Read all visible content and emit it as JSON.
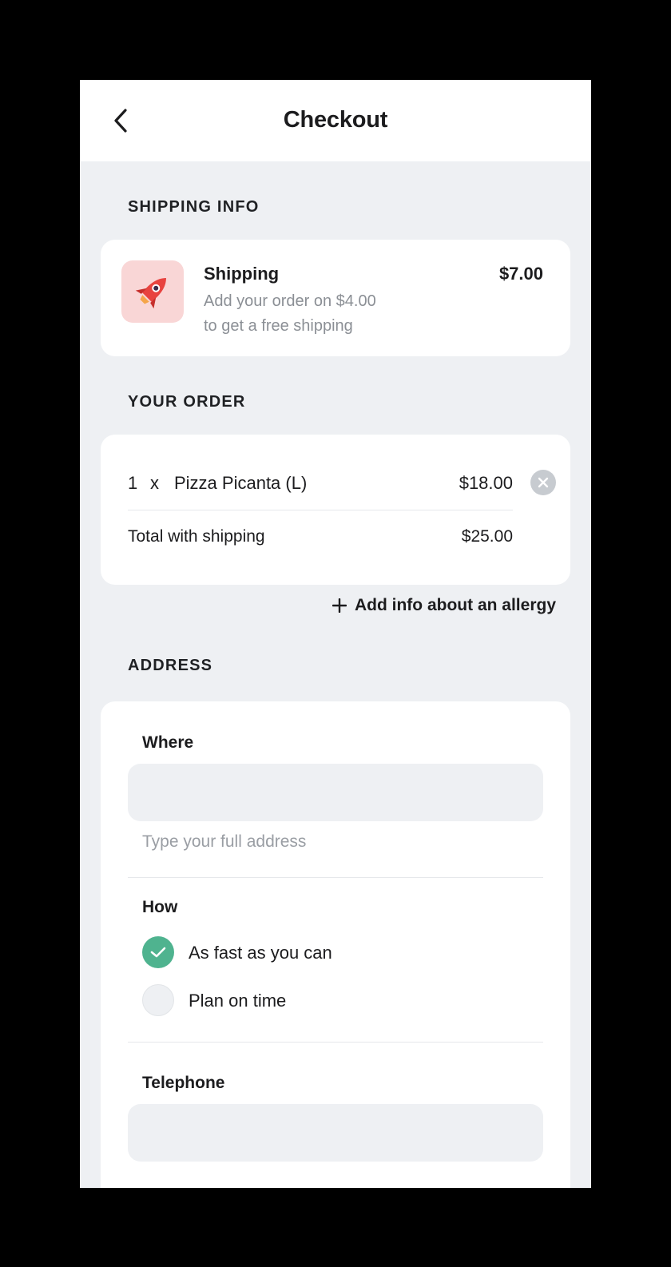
{
  "header": {
    "title": "Checkout",
    "back_icon": "chevron-left-icon"
  },
  "shipping_info": {
    "section_title": "SHIPPING INFO",
    "name": "Shipping",
    "description_line1": "Add your order on $4.00",
    "description_line2": "to get a free shipping",
    "price": "$7.00",
    "icon": "rocket-icon"
  },
  "your_order": {
    "section_title": "YOUR ORDER",
    "item": {
      "quantity": "1",
      "multiplier": "x",
      "name": "Pizza Picanta (L)",
      "price": "$18.00"
    },
    "total_label": "Total with shipping",
    "total_price": "$25.00"
  },
  "allergy": {
    "label": "Add info about an allergy",
    "icon": "plus-icon"
  },
  "address": {
    "section_title": "ADDRESS",
    "where_label": "Where",
    "where_value": "",
    "where_hint": "Type your full address",
    "how_label": "How",
    "options": [
      {
        "label": "As fast as you can",
        "selected": true
      },
      {
        "label": "Plan on time",
        "selected": false
      }
    ],
    "telephone_label": "Telephone",
    "telephone_value": ""
  },
  "colors": {
    "accent": "#4fb38f",
    "background": "#eef0f3",
    "card": "#ffffff",
    "rocket_tile": "#f9d6d6"
  }
}
